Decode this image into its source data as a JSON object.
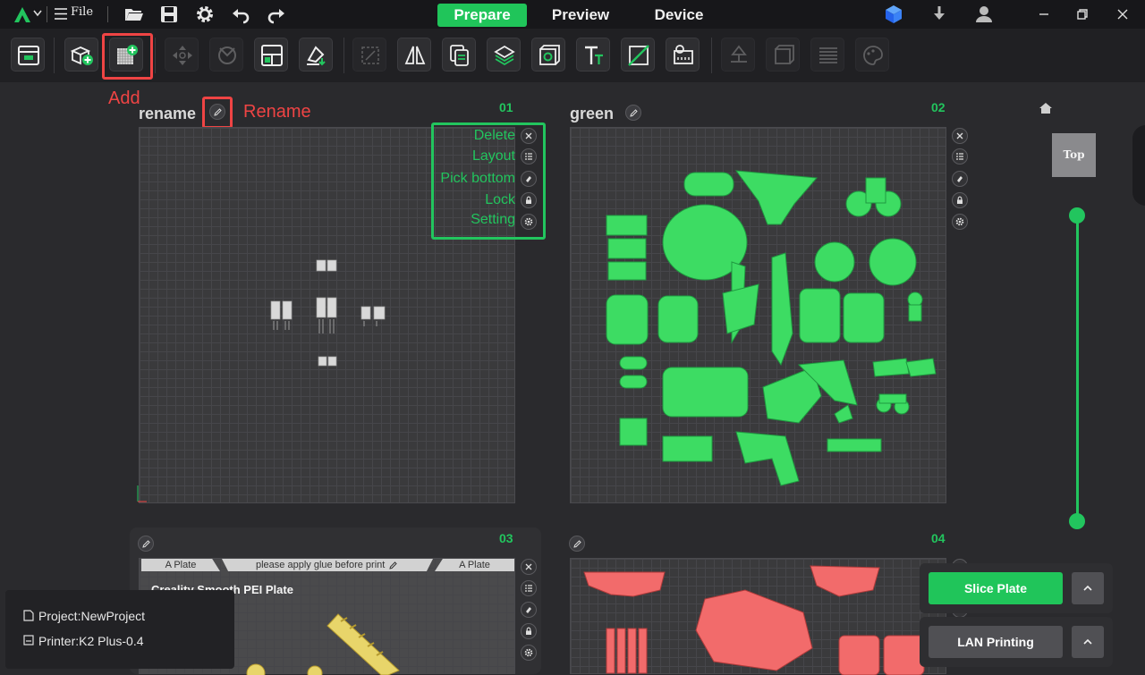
{
  "app": {
    "menu_file": "File",
    "tabs": [
      {
        "label": "Prepare",
        "active": true
      },
      {
        "label": "Preview",
        "active": false
      },
      {
        "label": "Device",
        "active": false
      }
    ],
    "accent": "#20c55a"
  },
  "annotations": {
    "add": "Add",
    "rename": "Rename",
    "menu": [
      "Delete",
      "Layout",
      "Pick bottom",
      "Lock",
      "Setting"
    ]
  },
  "plates": [
    {
      "number": "01",
      "name": "rename"
    },
    {
      "number": "02",
      "name": "green"
    },
    {
      "number": "03",
      "name": "",
      "header_left": "A Plate",
      "header_center": "please apply glue before print",
      "header_right": "A Plate",
      "plate_type": "Creality Smooth PEI Plate"
    },
    {
      "number": "04",
      "name": ""
    }
  ],
  "view": {
    "top_label": "Top"
  },
  "project": {
    "project_label": "Project:NewProject",
    "printer_label": "Printer:K2 Plus-0.4"
  },
  "actions": {
    "slice_plate": "Slice Plate",
    "lan_printing": "LAN Printing",
    "slice_color": "#20c55a"
  }
}
